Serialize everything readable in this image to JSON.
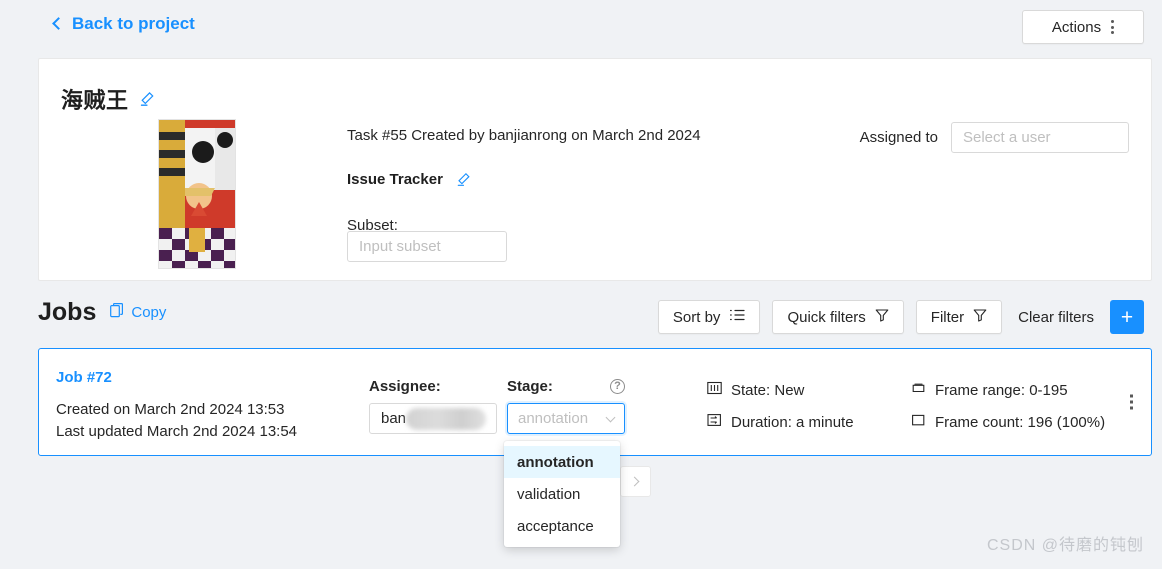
{
  "topbar": {
    "back_label": "Back to project",
    "back_icon": "chevron-left-icon",
    "actions_label": "Actions",
    "actions_icon": "vertical-dots-icon"
  },
  "task": {
    "title": "海贼王",
    "edit_icon": "pencil-icon",
    "thumbnail_alt": "task-thumbnail",
    "meta": "Task #55 Created by banjianrong on March 2nd 2024",
    "issue_tracker_label": "Issue Tracker",
    "issue_edit_icon": "pencil-icon",
    "subset_label": "Subset:",
    "subset_value": "",
    "subset_placeholder": "Input subset",
    "assigned_to_label": "Assigned to",
    "assignee_value": "",
    "assignee_placeholder": "Select a user"
  },
  "jobs_section": {
    "title": "Jobs",
    "copy_label": "Copy",
    "copy_icon": "copy-icon",
    "sort_by_label": "Sort by",
    "sort_by_icon": "sort-list-icon",
    "quick_filters_label": "Quick filters",
    "quick_filters_icon": "funnel-icon",
    "filter_label": "Filter",
    "filter_icon": "funnel-icon",
    "clear_filters_label": "Clear filters",
    "add_label": "+",
    "add_icon": "plus-icon"
  },
  "job": {
    "id_label": "Job #72",
    "created": "Created on March 2nd 2024 13:53",
    "updated": "Last updated March 2nd 2024 13:54",
    "assignee_label": "Assignee:",
    "assignee_value": "ban",
    "stage_label": "Stage:",
    "stage_help_icon": "question-circle-icon",
    "stage_value": "annotation",
    "stage_chevron_icon": "chevron-down-icon",
    "menu_icon": "vertical-dots-icon",
    "stats": [
      {
        "icon": "state-icon",
        "text": "State: New"
      },
      {
        "icon": "frame-range-icon",
        "text": "Frame range: 0-195"
      },
      {
        "icon": "duration-icon",
        "text": "Duration: a minute"
      },
      {
        "icon": "frame-count-icon",
        "text": "Frame count: 196 (100%)"
      }
    ]
  },
  "stage_dropdown": {
    "options": [
      {
        "label": "annotation",
        "selected": true
      },
      {
        "label": "validation",
        "selected": false
      },
      {
        "label": "acceptance",
        "selected": false
      }
    ]
  },
  "pagination": {
    "next_icon": "chevron-right-icon"
  },
  "watermark": {
    "text": "CSDN @待磨的钝刨"
  },
  "colors": {
    "accent": "#1890ff",
    "page_bg": "#f0f2f5",
    "card_bg": "#ffffff",
    "border": "#d9d9d9",
    "text": "#262626",
    "placeholder": "#bfbfbf",
    "dropdown_selected_bg": "#e6f7ff"
  }
}
